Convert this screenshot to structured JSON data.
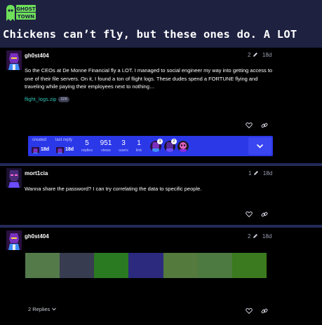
{
  "site": {
    "logo_text_top": "GHOST",
    "logo_text_bottom": "TOWN"
  },
  "topic": {
    "title": "Chickens can’t fly, but these ones do. A LOT"
  },
  "posts": [
    {
      "username": "gh0st404",
      "edits": "2",
      "age": "18d",
      "body": "So the CEOs at De Monne Financial fly a LOT. I managed to social engineer my way into getting access to one of their file servers. On it, I found a ton of flight logs. These dudes spend a FORTUNE flying and traveling while paying their employees next to nothing…",
      "attachment": {
        "name": "flight_logs.zip",
        "count": "328"
      }
    },
    {
      "username": "mort1cia",
      "edits": "1",
      "age": "18d",
      "body": "Wanna share the password? I can try correlating the data to specific people."
    },
    {
      "username": "gh0st404",
      "edits": "2",
      "age": "18d",
      "replies_label": "2 Replies"
    }
  ],
  "topic_map": {
    "created_label": "created",
    "created_value": "18d",
    "last_reply_label": "last reply",
    "last_reply_value": "18d",
    "replies_count": "5",
    "replies_label": "replies",
    "views_count": "951",
    "views_label": "views",
    "users_count": "3",
    "users_label": "users",
    "link_count": "1",
    "link_label": "link",
    "participant_badges": [
      "3",
      "2"
    ]
  },
  "palette": [
    "#547a4a",
    "#383c50",
    "#2a7a22",
    "#2c2a7e",
    "#547a3e",
    "#4d7a40",
    "#3b7a1e"
  ],
  "colors": {
    "accent": "#2b38e8",
    "link": "#2ec4b6",
    "page_bg": "#1e2140",
    "post_bg": "#000000"
  },
  "icons": [
    "ghost-town-logo",
    "pencil-icon",
    "heart-icon",
    "link-icon",
    "chevron-down-icon"
  ]
}
